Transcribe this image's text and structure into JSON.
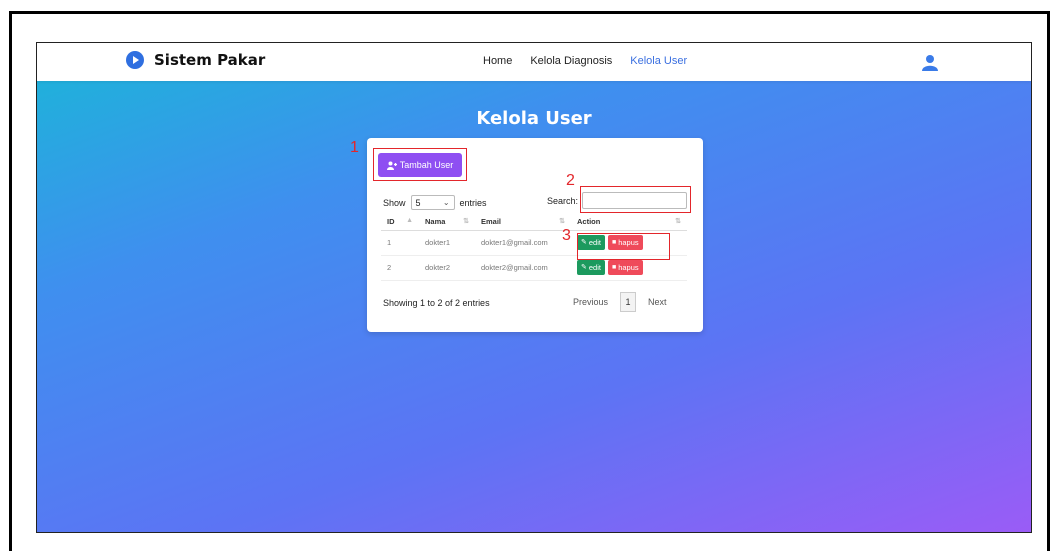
{
  "navbar": {
    "brand": "Sistem Pakar",
    "links": [
      {
        "label": "Home",
        "active": false
      },
      {
        "label": "Kelola Diagnosis",
        "active": false
      },
      {
        "label": "Kelola User",
        "active": true
      }
    ]
  },
  "page": {
    "title": "Kelola User"
  },
  "card": {
    "add_button": "Tambah User",
    "show_label": "Show",
    "length_value": "5",
    "entries_label": "entries",
    "search_label": "Search:",
    "search_value": "",
    "columns": [
      "ID",
      "Nama",
      "Email",
      "Action"
    ],
    "rows": [
      {
        "id": "1",
        "nama": "dokter1",
        "email": "dokter1@gmail.com"
      },
      {
        "id": "2",
        "nama": "dokter2",
        "email": "dokter2@gmail.com"
      }
    ],
    "edit_label": "edit",
    "delete_label": "hapus",
    "info": "Showing 1 to 2 of 2 entries",
    "pagination": {
      "previous": "Previous",
      "current": "1",
      "next": "Next"
    }
  },
  "annotations": [
    "1",
    "2",
    "3"
  ],
  "colors": {
    "accent_purple": "#8e4ff2",
    "edit_green": "#1c9a5e",
    "delete_red": "#ef4a5a",
    "annotation_red": "#e3262b",
    "nav_active": "#3a6fe0"
  }
}
